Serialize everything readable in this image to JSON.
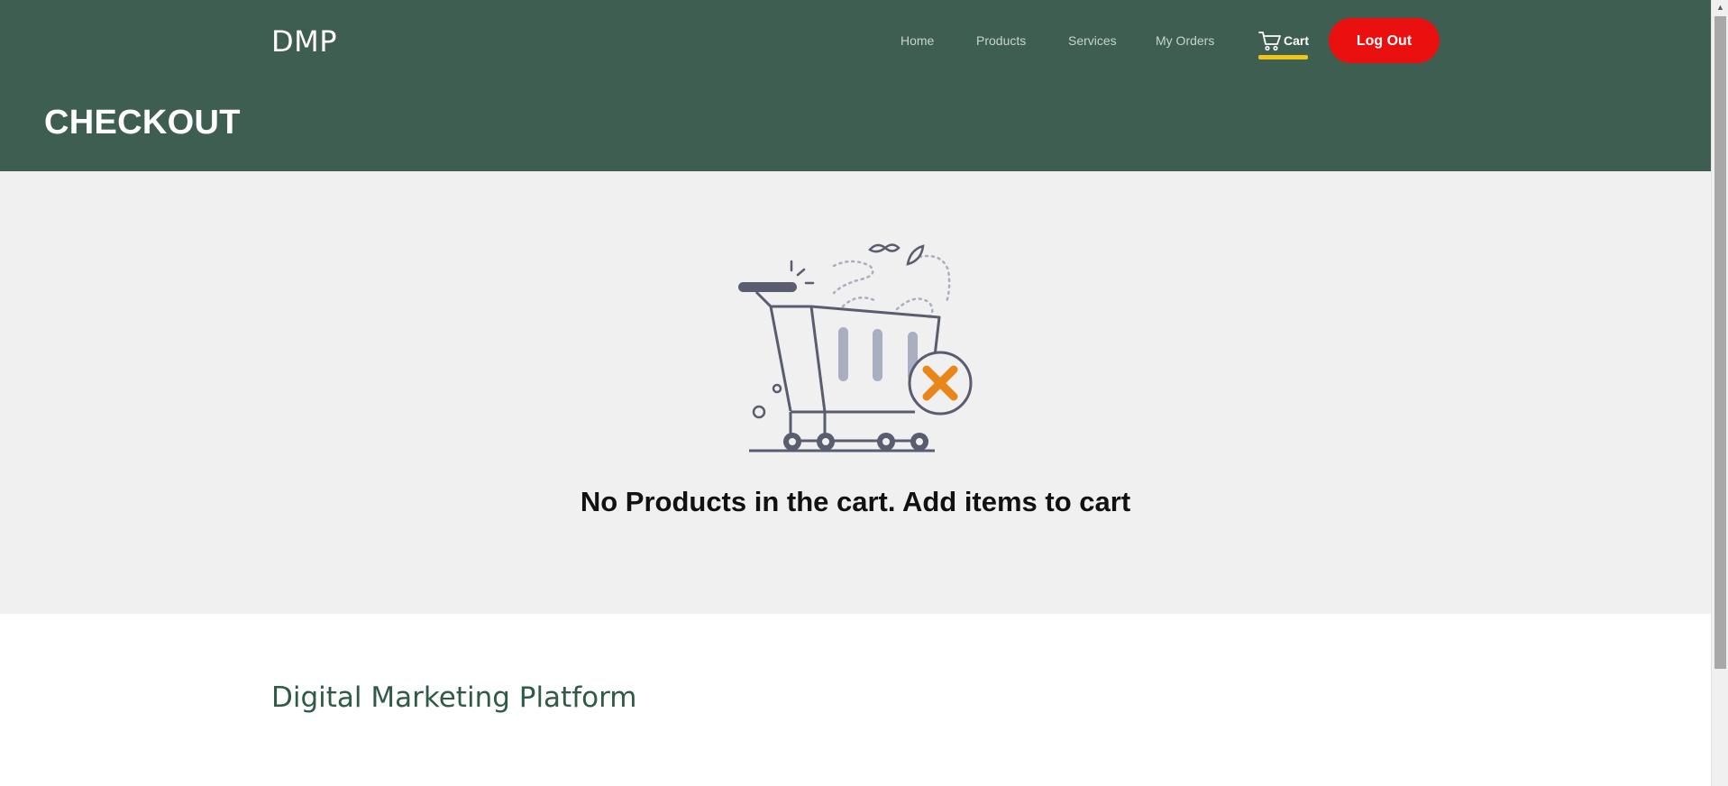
{
  "header": {
    "brand": "DMP",
    "nav": {
      "home": "Home",
      "products": "Products",
      "services": "Services",
      "my_orders": "My Orders",
      "cart": "Cart"
    },
    "logout_label": "Log Out",
    "page_title": "CHECKOUT"
  },
  "empty_cart": {
    "message": "No Products in the cart. Add items to cart",
    "illustration_icon": "empty-cart-illustration"
  },
  "footer": {
    "title": "Digital Marketing Platform"
  },
  "colors": {
    "header_bg": "#3d5e50",
    "logout_bg": "#ea1010",
    "cart_underline": "#f0c419",
    "section_bg": "#eff0ef",
    "footer_title": "#2f5a46",
    "x_orange": "#e8861a"
  }
}
